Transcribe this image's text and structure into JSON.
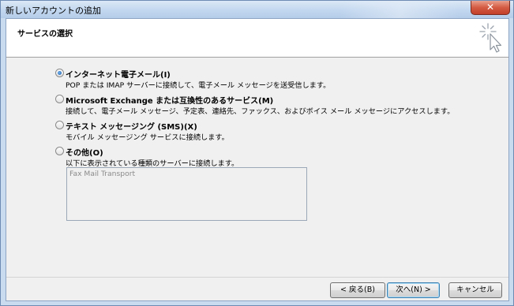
{
  "window": {
    "title": "新しいアカウントの追加",
    "close_label": "✕"
  },
  "header": {
    "title": "サービスの選択",
    "icon": "cursor-sparkle-icon"
  },
  "options": [
    {
      "label": "インターネット電子メール(I)",
      "description": "POP または IMAP サーバーに接続して、電子メール メッセージを送受信します。",
      "checked": true
    },
    {
      "label": "Microsoft Exchange または互換性のあるサービス(M)",
      "description": "接続して、電子メール メッセージ、予定表、連絡先、ファックス、およびボイス メール メッセージにアクセスします。",
      "checked": false
    },
    {
      "label": "テキスト メッセージング (SMS)(X)",
      "description": "モバイル メッセージング サービスに接続します。",
      "checked": false
    },
    {
      "label": "その他(O)",
      "description": "以下に表示されている種類のサーバーに接続します。",
      "checked": false
    }
  ],
  "other_list": {
    "items": [
      "Fax Mail Transport"
    ]
  },
  "buttons": {
    "back": "< 戻る(B)",
    "next": "次へ(N) >",
    "cancel": "キャンセル"
  }
}
